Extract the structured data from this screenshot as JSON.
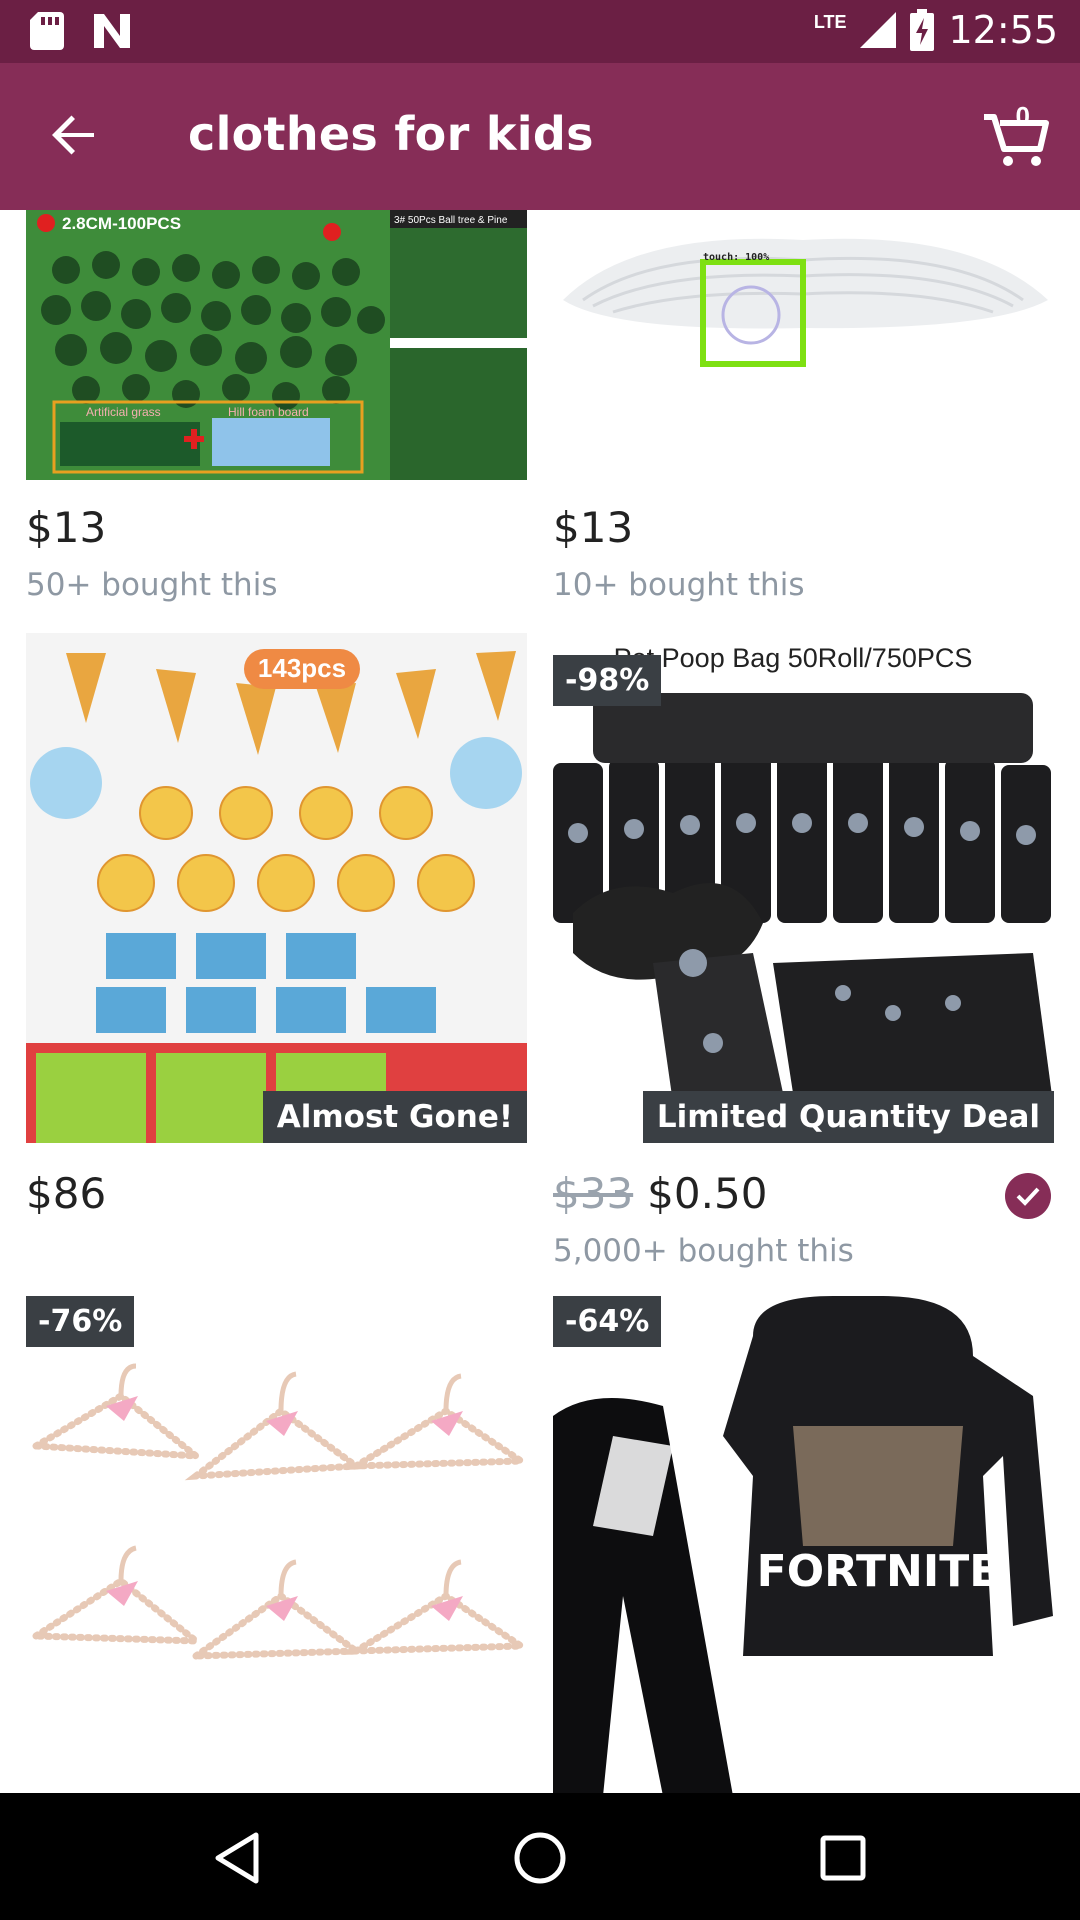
{
  "status_bar": {
    "time": "12:55",
    "network": "LTE"
  },
  "app_bar": {
    "title": "clothes for kids",
    "cart_count": "0"
  },
  "products": [
    {
      "price": "$13",
      "bought": "50+ bought this",
      "image_text": [
        "2.8CM-100PCS",
        "3# 50Pcs Ball tree & Pine",
        "Artificial grass",
        "Hill foam board"
      ]
    },
    {
      "price": "$13",
      "bought": "10+ bought this",
      "overlay_text": "touch: 100%"
    },
    {
      "price": "$86",
      "deal_badge": "Almost Gone!",
      "image_text": [
        "143pcs"
      ]
    },
    {
      "discount": "-98%",
      "old_price": "$33",
      "price": "$0.50",
      "bought": "5,000+ bought this",
      "deal_badge": "Limited Quantity Deal",
      "image_text": [
        "Pet Poop Bag 50Roll/750PCS"
      ]
    },
    {
      "discount": "-76%"
    },
    {
      "discount": "-64%",
      "image_text": [
        "FORTNITE"
      ]
    }
  ],
  "colors": {
    "status_bar": "#6b1f44",
    "app_bar": "#862d57",
    "badge": "#3a3f44",
    "nav_bar": "#000000"
  }
}
